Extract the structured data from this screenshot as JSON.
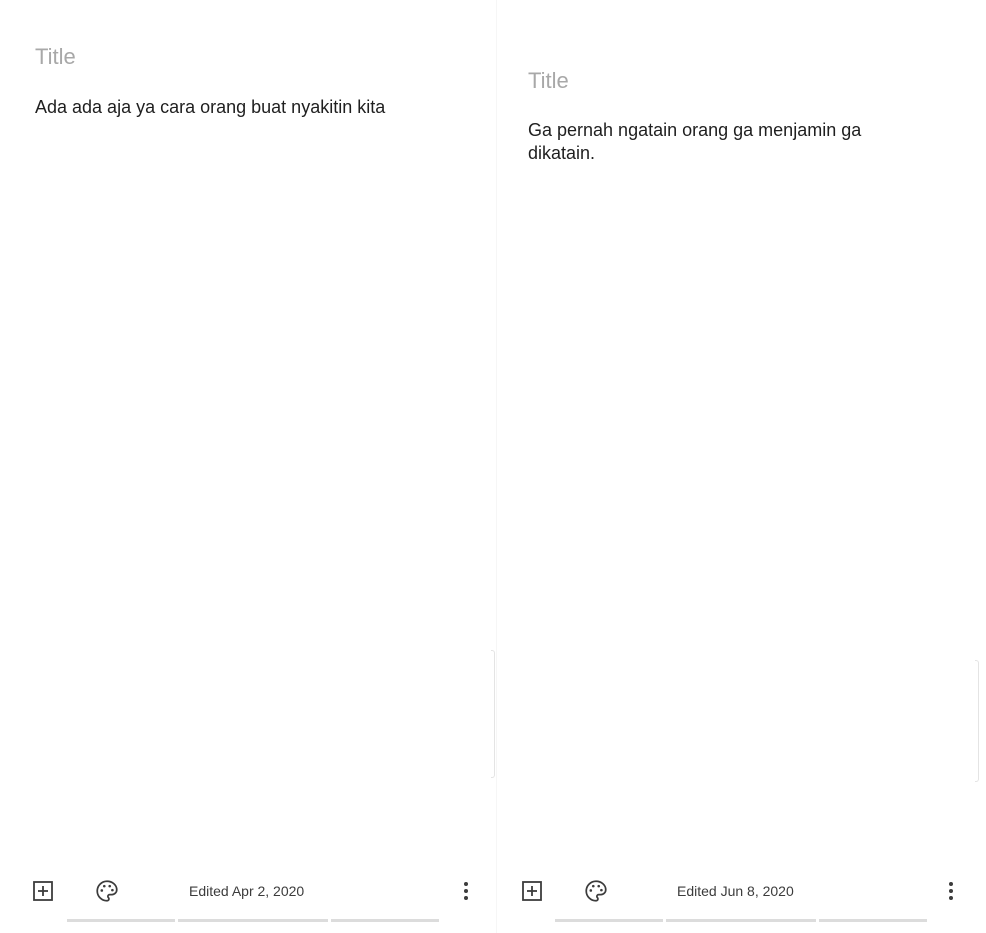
{
  "left_note": {
    "title_placeholder": "Title",
    "body": "Ada ada aja ya cara orang buat nyakitin kita",
    "edited": "Edited Apr 2, 2020"
  },
  "right_note": {
    "title_placeholder": "Title",
    "body": "Ga pernah ngatain orang ga menjamin ga dikatain.",
    "edited": "Edited Jun 8, 2020"
  },
  "icons": {
    "add": "add-box-icon",
    "palette": "palette-icon",
    "more": "more-vert-icon"
  },
  "colors": {
    "background": "#ffffff",
    "title_placeholder": "#a8a8a8",
    "body_text": "#1f1f1f",
    "icon": "#3c3c3c"
  }
}
